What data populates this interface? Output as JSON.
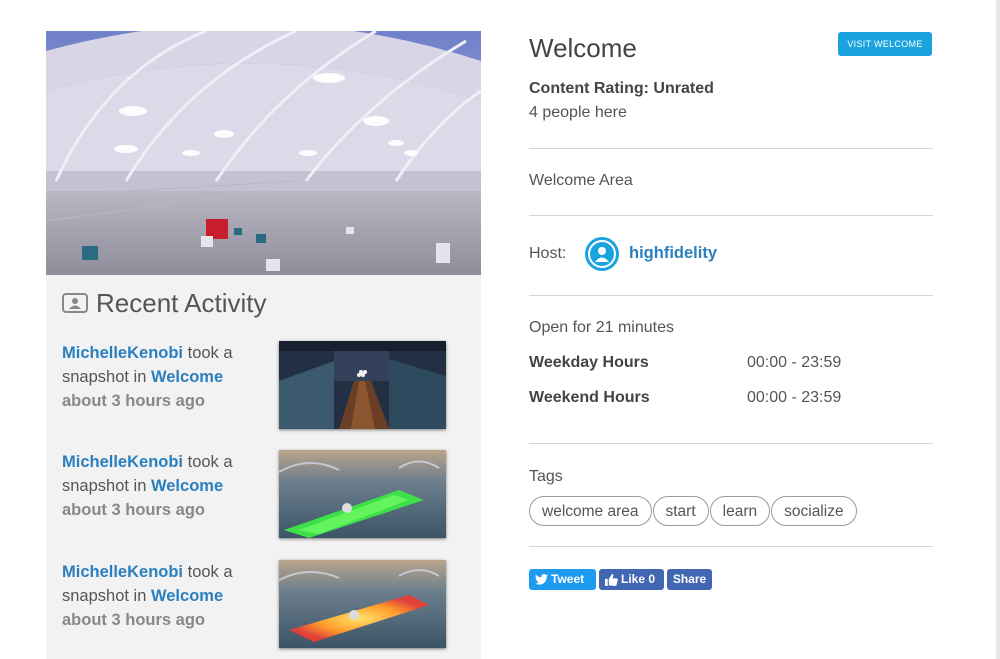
{
  "recent_activity": {
    "title": "Recent Activity",
    "items": [
      {
        "user": "MichelleKenobi",
        "action": " took a snapshot in ",
        "place": "Welcome",
        "time": "about 3 hours ago",
        "thumbnail": "bowling-lane-snapshot"
      },
      {
        "user": "MichelleKenobi",
        "action": " took a snapshot in ",
        "place": "Welcome",
        "time": "about 3 hours ago",
        "thumbnail": "green-glow-snapshot"
      },
      {
        "user": "MichelleKenobi",
        "action": " took a snapshot in ",
        "place": "Welcome",
        "time": "about 3 hours ago",
        "thumbnail": "orange-glow-snapshot"
      }
    ]
  },
  "place": {
    "name": "Welcome",
    "visit_button": "VISIT WELCOME",
    "content_rating": "Content Rating: Unrated",
    "people_here": "4 people here",
    "description": "Welcome Area",
    "host_label": "Host:",
    "host_name": "highfidelity",
    "open_for": "Open for 21 minutes",
    "hours": [
      {
        "label": "Weekday Hours",
        "value": "00:00 - 23:59"
      },
      {
        "label": "Weekend Hours",
        "value": "00:00 - 23:59"
      }
    ],
    "tags_label": "Tags",
    "tags": [
      "welcome area",
      "start",
      "learn",
      "socialize"
    ]
  },
  "share": {
    "tweet": "Tweet",
    "like": "Like 0",
    "share": "Share"
  },
  "colors": {
    "accent": "#1ba3e0",
    "link": "#2a7fbf",
    "facebook": "#4267b2",
    "twitter": "#1d9bf0"
  }
}
